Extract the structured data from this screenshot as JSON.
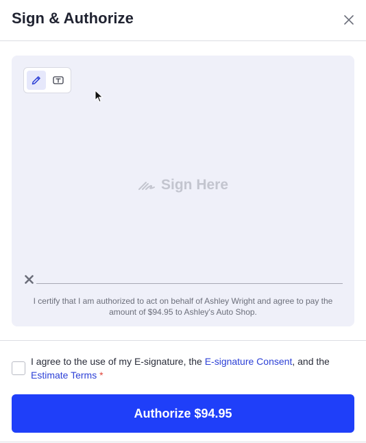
{
  "header": {
    "title": "Sign & Authorize",
    "close_icon": "close-icon"
  },
  "signature": {
    "modes": [
      {
        "name": "draw",
        "icon": "pencil-icon",
        "active": true
      },
      {
        "name": "type",
        "icon": "text-box-icon",
        "active": false
      }
    ],
    "placeholder": "Sign Here",
    "placeholder_icon": "signature-icon",
    "clear_icon": "clear-x-icon",
    "certify_text": "I certify that I am authorized to act on behalf of Ashley Wright and agree to pay the amount of $94.95 to Ashley's Auto Shop."
  },
  "consent": {
    "checked": false,
    "text_before": "I agree to the use of my E-signature, the ",
    "consent_link": "E-signature Consent",
    "text_middle": ", and the ",
    "terms_link": "Estimate Terms",
    "required_mark": "*"
  },
  "actions": {
    "authorize_label": "Authorize $94.95"
  },
  "colors": {
    "primary": "#1f3ff9",
    "link": "#2b3fd6",
    "sign_area_bg": "#eff0f9",
    "required": "#e0453a"
  }
}
